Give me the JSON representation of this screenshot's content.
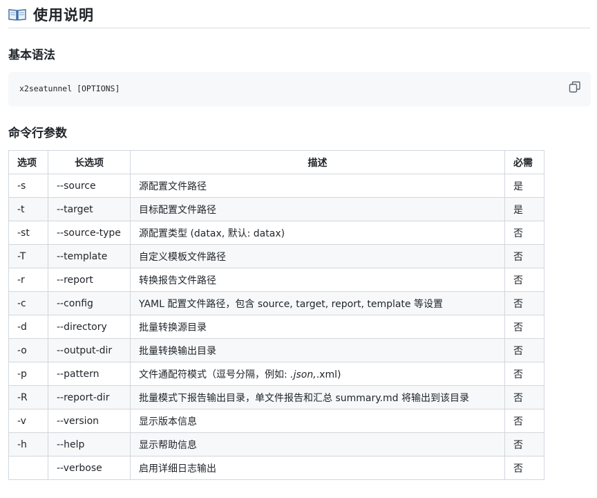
{
  "header": {
    "title": "使用说明",
    "icon": "book-icon"
  },
  "sections": {
    "basic_syntax": "基本语法",
    "cli_args": "命令行参数"
  },
  "code": {
    "text": "x2seatunnel [OPTIONS]",
    "copy_icon": "copy-icon"
  },
  "table": {
    "headers": [
      "选项",
      "长选项",
      "描述",
      "必需"
    ],
    "rows": [
      {
        "short": "-s",
        "long": "--source",
        "desc": "源配置文件路径",
        "required": "是"
      },
      {
        "short": "-t",
        "long": "--target",
        "desc": "目标配置文件路径",
        "required": "是"
      },
      {
        "short": "-st",
        "long": "--source-type",
        "desc": "源配置类型 (datax, 默认: datax)",
        "required": "否"
      },
      {
        "short": "-T",
        "long": "--template",
        "desc": "自定义模板文件路径",
        "required": "否"
      },
      {
        "short": "-r",
        "long": "--report",
        "desc": "转换报告文件路径",
        "required": "否"
      },
      {
        "short": "-c",
        "long": "--config",
        "desc": "YAML 配置文件路径，包含 source, target, report, template 等设置",
        "required": "否"
      },
      {
        "short": "-d",
        "long": "--directory",
        "desc": "批量转换源目录",
        "required": "否"
      },
      {
        "short": "-o",
        "long": "--output-dir",
        "desc": "批量转换输出目录",
        "required": "否"
      },
      {
        "short": "-p",
        "long": "--pattern",
        "desc_pre": "文件通配符模式（逗号分隔，例如: ",
        "desc_em": ".json,",
        "desc_post": ".xml)",
        "required": "否"
      },
      {
        "short": "-R",
        "long": "--report-dir",
        "desc": "批量模式下报告输出目录，单文件报告和汇总 summary.md 将输出到该目录",
        "required": "否"
      },
      {
        "short": "-v",
        "long": "--version",
        "desc": "显示版本信息",
        "required": "否"
      },
      {
        "short": "-h",
        "long": "--help",
        "desc": "显示帮助信息",
        "required": "否"
      },
      {
        "short": "",
        "long": "--verbose",
        "desc": "启用详细日志输出",
        "required": "否"
      }
    ]
  }
}
